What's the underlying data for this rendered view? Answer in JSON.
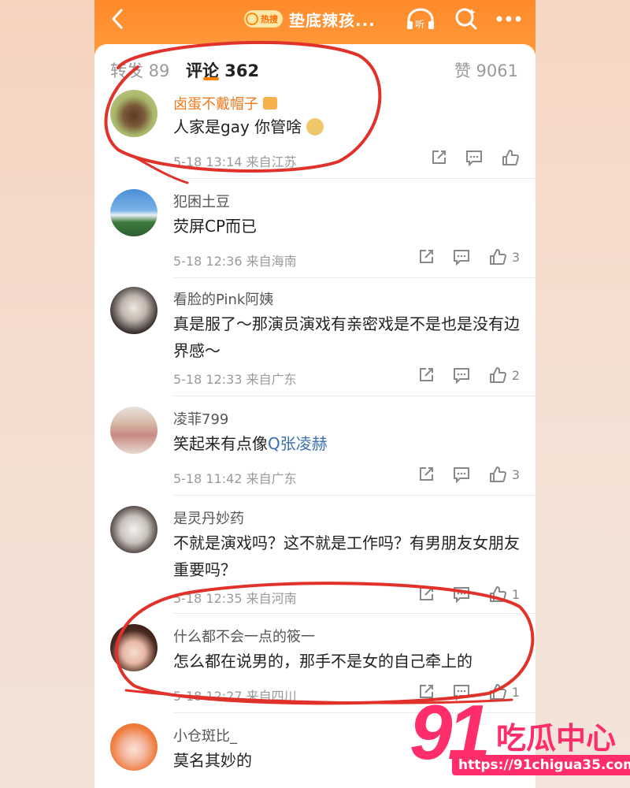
{
  "header": {
    "hot_badge": "热搜",
    "title": "垫底辣孩...",
    "listen_label": "听"
  },
  "tabs": {
    "repost": "转发 89",
    "comments": "评论 362",
    "likes": "赞 9061"
  },
  "comments": [
    {
      "name": "卤蛋不戴帽子",
      "text": "人家是gay 你管啥",
      "meta": "5-18 13:14 来自江苏",
      "likes": ""
    },
    {
      "name": "犯困土豆",
      "text": "荧屏CP而已",
      "meta": "5-18 12:36 来自海南",
      "likes": "3"
    },
    {
      "name": "看脸的Pink阿姨",
      "text": "真是服了～那演员演戏有亲密戏是不是也是没有边界感～",
      "meta": "5-18 12:33 来自广东",
      "likes": "2"
    },
    {
      "name": "凌菲799",
      "text_prefix": "笑起来有点像",
      "text_link": "Q张凌赫",
      "meta": "5-18 11:42 来自广东",
      "likes": "3"
    },
    {
      "name": "是灵丹妙药",
      "text": "不就是演戏吗？这不就是工作吗？有男朋友女朋友重要吗？",
      "meta": "5-18 12:35 来自河南",
      "likes": "1"
    },
    {
      "name": "什么都不会一点的筱一",
      "text": "怎么都在说男的，那手不是女的自己牵上的",
      "meta": "5-18 12:27 来自四川",
      "likes": "1"
    },
    {
      "name": "小仓斑比_",
      "text": "莫名其妙的",
      "meta": "",
      "likes": ""
    }
  ],
  "watermark": {
    "number": "91",
    "name": "吃瓜中心",
    "url": "https://91chigua35.com"
  },
  "colors": {
    "header": "#ff8a2a",
    "accent": "#ff8200",
    "annotation": "#e0322a",
    "watermark": "#ff2d6a"
  }
}
